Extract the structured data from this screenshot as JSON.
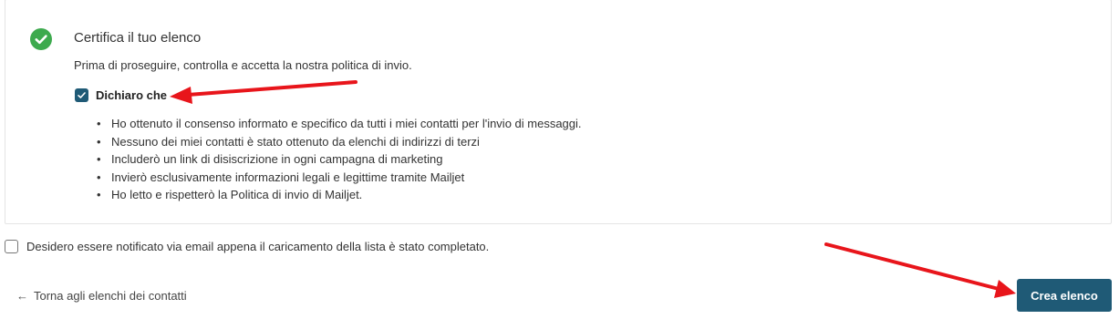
{
  "certify": {
    "title": "Certifica il tuo elenco",
    "description": "Prima di proseguire, controlla e accetta la nostra politica di invio.",
    "declare_label": "Dichiaro che",
    "declare_checked": true,
    "bullets": [
      "Ho ottenuto il consenso informato e specifico da tutti i miei contatti per l'invio di messaggi.",
      "Nessuno dei miei contatti è stato ottenuto da elenchi di indirizzi di terzi",
      "Includerò un link di disiscrizione in ogni campagna di marketing",
      "Invierò esclusivamente informazioni legali e legittime tramite Mailjet",
      "Ho letto e rispetterò la Politica di invio di Mailjet."
    ],
    "bullet_char": "•"
  },
  "notify": {
    "label": "Desidero essere notificato via email appena il caricamento della lista è stato completato.",
    "checked": false
  },
  "footer": {
    "back_arrow": "←",
    "back_label": "Torna agli elenchi dei contatti",
    "create_label": "Crea elenco"
  },
  "colors": {
    "accent": "#1f5a76",
    "success": "#3daa4e",
    "annotation_arrow": "#e8151b"
  },
  "icons": {
    "status": "check-circle-icon",
    "checkbox": "checkmark-icon",
    "back": "arrow-left-icon"
  }
}
